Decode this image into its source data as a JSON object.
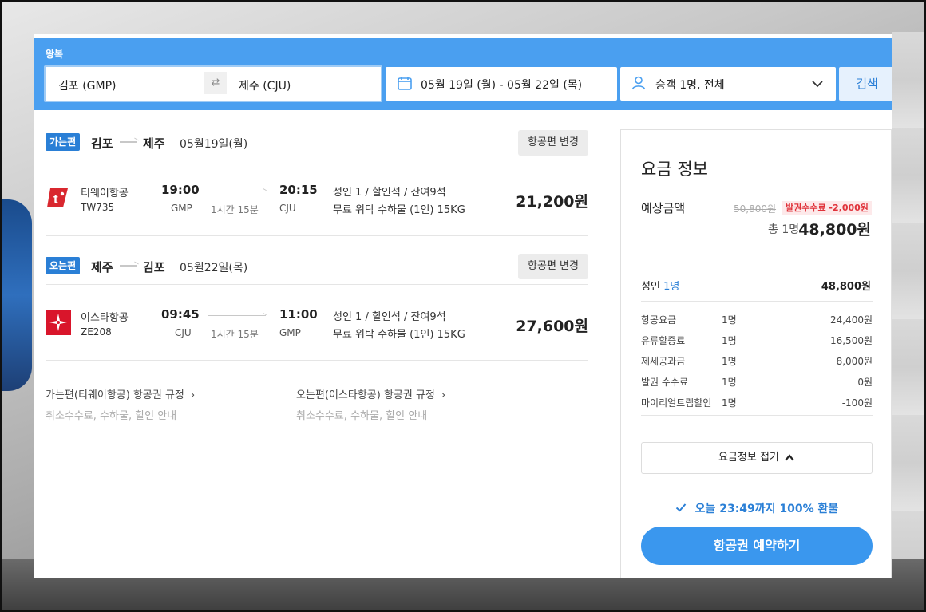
{
  "search": {
    "trip_type": "왕복",
    "origin": "김포 (GMP)",
    "swap_icon": "⇄",
    "destination": "제주 (CJU)",
    "dates": "05월 19일 (월)  -  05월 22일 (목)",
    "passengers": "승객 1명, 전체",
    "search_label": "검색"
  },
  "segments": [
    {
      "badge": "가는편",
      "from": "김포",
      "to": "제주",
      "date": "05월19일(월)",
      "change_label": "항공편 변경",
      "airline": "티웨이항공",
      "flight_no": "TW735",
      "dep_time": "19:00",
      "dep_airport": "GMP",
      "duration": "1시간 15분",
      "arr_time": "20:15",
      "arr_airport": "CJU",
      "seat_info": "성인 1 / 할인석 / 잔여9석",
      "baggage": "무료 위탁 수하물 (1인) 15KG",
      "price": "21,200원",
      "logo_color": "#d9282f"
    },
    {
      "badge": "오는편",
      "from": "제주",
      "to": "김포",
      "date": "05월22일(목)",
      "change_label": "항공편 변경",
      "airline": "이스타항공",
      "flight_no": "ZE208",
      "dep_time": "09:45",
      "dep_airport": "CJU",
      "duration": "1시간 15분",
      "arr_time": "11:00",
      "arr_airport": "GMP",
      "seat_info": "성인 1 / 할인석 / 잔여9석",
      "baggage": "무료 위탁 수하물 (1인) 15KG",
      "price": "27,600원",
      "logo_color": "#d9152b"
    }
  ],
  "rules": {
    "outbound_link": "가는편(티웨이항공) 항공권 규정",
    "outbound_sub": "취소수수료, 수하물, 할인 안내",
    "inbound_link": "오는편(이스타항공) 항공권 규정",
    "inbound_sub": "취소수수료, 수하물, 할인 안내",
    "chevron": "›"
  },
  "fare": {
    "title": "요금 정보",
    "estimate_label": "예상금액",
    "original_price": "50,800원",
    "fee_badge": "발권수수료 -2,000원",
    "total_label": "총 1명",
    "total_price": "48,800원",
    "adult_label": "성인",
    "adult_count": "1명",
    "adult_amount": "48,800원",
    "breakdown": [
      {
        "name": "항공요금",
        "count": "1명",
        "amount": "24,400원"
      },
      {
        "name": "유류할증료",
        "count": "1명",
        "amount": "16,500원"
      },
      {
        "name": "제세공과금",
        "count": "1명",
        "amount": "8,000원"
      },
      {
        "name": "발권 수수료",
        "count": "1명",
        "amount": "0원"
      },
      {
        "name": "마이리얼트립할인",
        "count": "1명",
        "amount": "-100원"
      }
    ],
    "collapse_label": "요금정보 접기",
    "refund_note": "오늘 23:49까지 100% 환불",
    "book_label": "항공권 예약하기"
  },
  "colors": {
    "accent": "#4a9ff0",
    "primary_button": "#3a97ee",
    "badge": "#2a7fd6",
    "discount_red": "#e0323a"
  }
}
